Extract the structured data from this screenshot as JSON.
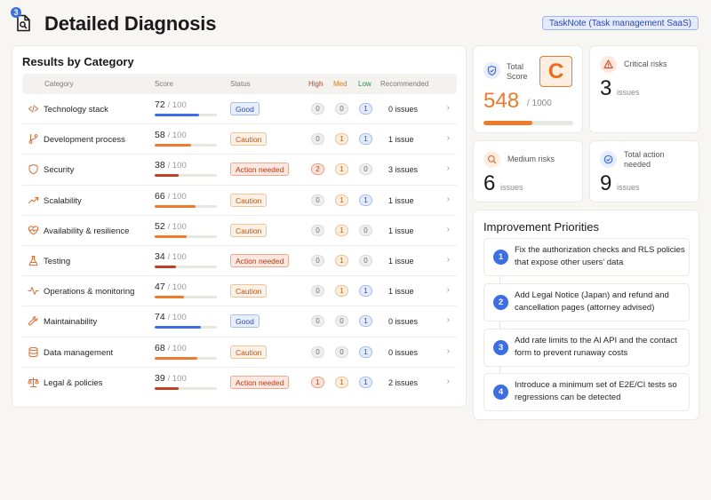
{
  "header": {
    "logo_badge": "3",
    "title": "Detailed Diagnosis",
    "product_tag": "TaskNote (Task management SaaS)"
  },
  "results": {
    "title": "Results by Category",
    "columns": {
      "category": "Category",
      "score": "Score",
      "status": "Status",
      "high": "High",
      "med": "Med",
      "low": "Low",
      "recommended": "Recommended"
    },
    "rows": [
      {
        "icon": "code-icon",
        "category": "Technology stack",
        "score": "72",
        "max": "/ 100",
        "score_pct": 72,
        "bar_color": "#3b6ee8",
        "status": "Good",
        "status_kind": "good",
        "high": "0",
        "med": "0",
        "low": "1",
        "recommended": "0 issues"
      },
      {
        "icon": "git-branch-icon",
        "category": "Development process",
        "score": "58",
        "max": "/ 100",
        "score_pct": 58,
        "bar_color": "#ef7a2c",
        "status": "Caution",
        "status_kind": "caution",
        "high": "0",
        "med": "1",
        "low": "1",
        "recommended": "1 issue"
      },
      {
        "icon": "shield-icon",
        "category": "Security",
        "score": "38",
        "max": "/ 100",
        "score_pct": 38,
        "bar_color": "#c43c21",
        "status": "Action needed",
        "status_kind": "action",
        "high": "2",
        "med": "1",
        "low": "0",
        "recommended": "3 issues"
      },
      {
        "icon": "trending-up-icon",
        "category": "Scalability",
        "score": "66",
        "max": "/ 100",
        "score_pct": 66,
        "bar_color": "#ef7a2c",
        "status": "Caution",
        "status_kind": "caution",
        "high": "0",
        "med": "1",
        "low": "1",
        "recommended": "1 issue"
      },
      {
        "icon": "heart-pulse-icon",
        "category": "Availability & resilience",
        "score": "52",
        "max": "/ 100",
        "score_pct": 52,
        "bar_color": "#ef7a2c",
        "status": "Caution",
        "status_kind": "caution",
        "high": "0",
        "med": "1",
        "low": "0",
        "recommended": "1 issue"
      },
      {
        "icon": "flask-icon",
        "category": "Testing",
        "score": "34",
        "max": "/ 100",
        "score_pct": 34,
        "bar_color": "#c43c21",
        "status": "Action needed",
        "status_kind": "action",
        "high": "0",
        "med": "1",
        "low": "0",
        "recommended": "1 issue"
      },
      {
        "icon": "activity-icon",
        "category": "Operations & monitoring",
        "score": "47",
        "max": "/ 100",
        "score_pct": 47,
        "bar_color": "#ef7a2c",
        "status": "Caution",
        "status_kind": "caution",
        "high": "0",
        "med": "1",
        "low": "1",
        "recommended": "1 issue"
      },
      {
        "icon": "wrench-icon",
        "category": "Maintainability",
        "score": "74",
        "max": "/ 100",
        "score_pct": 74,
        "bar_color": "#3b6ee8",
        "status": "Good",
        "status_kind": "good",
        "high": "0",
        "med": "0",
        "low": "1",
        "recommended": "0 issues"
      },
      {
        "icon": "database-icon",
        "category": "Data management",
        "score": "68",
        "max": "/ 100",
        "score_pct": 68,
        "bar_color": "#ef7a2c",
        "status": "Caution",
        "status_kind": "caution",
        "high": "0",
        "med": "0",
        "low": "1",
        "recommended": "0 issues"
      },
      {
        "icon": "scale-icon",
        "category": "Legal & policies",
        "score": "39",
        "max": "/ 100",
        "score_pct": 39,
        "bar_color": "#c43c21",
        "status": "Action needed",
        "status_kind": "action",
        "high": "1",
        "med": "1",
        "low": "1",
        "recommended": "2 issues"
      }
    ]
  },
  "total_score": {
    "label_line1": "Total",
    "label_line2": "Score",
    "grade": "C",
    "value": "548",
    "max": "/ 1000",
    "pct": 54.8
  },
  "critical_risks": {
    "label": "Critical risks",
    "value": "3",
    "unit": "issues"
  },
  "medium_risks": {
    "label": "Medium risks",
    "value": "6",
    "unit": "issues"
  },
  "total_actions": {
    "label_line1": "Total action",
    "label_line2": "needed",
    "value": "9",
    "unit": "issues"
  },
  "priorities": {
    "title": "Improvement Priorities",
    "items": [
      {
        "num": "1",
        "text": "Fix the authorization checks and RLS policies that expose other users' data"
      },
      {
        "num": "2",
        "text": "Add Legal Notice (Japan) and refund and cancellation pages (attorney advised)"
      },
      {
        "num": "3",
        "text": "Add rate limits to the AI API and the contact form to prevent runaway costs"
      },
      {
        "num": "4",
        "text": "Introduce a minimum set of E2E/CI tests so regressions can be detected"
      }
    ]
  },
  "colors": {
    "accent_blue": "#3b6ee8",
    "accent_orange": "#ef7a2c",
    "danger_red": "#c43c21"
  }
}
